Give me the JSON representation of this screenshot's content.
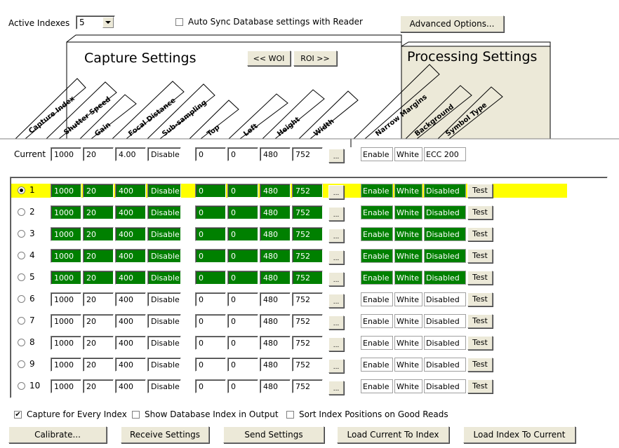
{
  "toolbar": {
    "active_indexes_label": "Active Indexes",
    "active_indexes_value": "5",
    "auto_sync_label": "Auto Sync Database settings with Reader",
    "auto_sync_checked": false,
    "advanced_options_label": "Advanced Options..."
  },
  "capture_panel": {
    "title": "Capture Settings",
    "woi_button": "<< WOI",
    "roi_button": "ROI >>",
    "headers": [
      "Capture Index",
      "Shutter Speed",
      "Gain",
      "Focal Distance",
      "Sub-sampling",
      "Top",
      "Left",
      "Height",
      "Width"
    ]
  },
  "processing_panel": {
    "title": "Processing Settings",
    "headers": [
      "Narrow Margins",
      "Background",
      "Symbol Type"
    ]
  },
  "current": {
    "label": "Current",
    "shutter": "1000",
    "gain": "20",
    "focal": "4.00",
    "subsampling": "Disable",
    "top": "0",
    "left": "0",
    "height": "480",
    "width": "752",
    "ellipsis": "...",
    "narrow_margins": "Enable",
    "background": "White",
    "symbol_type": "ECC 200"
  },
  "rows": [
    {
      "num": "1",
      "selected": true,
      "active": true,
      "shutter": "1000",
      "gain": "20",
      "focal": "400",
      "subsampling": "Disable",
      "top": "0",
      "left": "0",
      "height": "480",
      "width": "752",
      "ellipsis": "...",
      "narrow_margins": "Enable",
      "background": "White",
      "symbol_type": "Disabled",
      "test": "Test"
    },
    {
      "num": "2",
      "selected": false,
      "active": true,
      "shutter": "1000",
      "gain": "20",
      "focal": "400",
      "subsampling": "Disable",
      "top": "0",
      "left": "0",
      "height": "480",
      "width": "752",
      "ellipsis": "...",
      "narrow_margins": "Enable",
      "background": "White",
      "symbol_type": "Disabled",
      "test": "Test"
    },
    {
      "num": "3",
      "selected": false,
      "active": true,
      "shutter": "1000",
      "gain": "20",
      "focal": "400",
      "subsampling": "Disable",
      "top": "0",
      "left": "0",
      "height": "480",
      "width": "752",
      "ellipsis": "...",
      "narrow_margins": "Enable",
      "background": "White",
      "symbol_type": "Disabled",
      "test": "Test"
    },
    {
      "num": "4",
      "selected": false,
      "active": true,
      "shutter": "1000",
      "gain": "20",
      "focal": "400",
      "subsampling": "Disable",
      "top": "0",
      "left": "0",
      "height": "480",
      "width": "752",
      "ellipsis": "...",
      "narrow_margins": "Enable",
      "background": "White",
      "symbol_type": "Disabled",
      "test": "Test"
    },
    {
      "num": "5",
      "selected": false,
      "active": true,
      "shutter": "1000",
      "gain": "20",
      "focal": "400",
      "subsampling": "Disable",
      "top": "0",
      "left": "0",
      "height": "480",
      "width": "752",
      "ellipsis": "...",
      "narrow_margins": "Enable",
      "background": "White",
      "symbol_type": "Disabled",
      "test": "Test"
    },
    {
      "num": "6",
      "selected": false,
      "active": false,
      "shutter": "1000",
      "gain": "20",
      "focal": "400",
      "subsampling": "Disable",
      "top": "0",
      "left": "0",
      "height": "480",
      "width": "752",
      "ellipsis": "...",
      "narrow_margins": "Enable",
      "background": "White",
      "symbol_type": "Disabled",
      "test": "Test"
    },
    {
      "num": "7",
      "selected": false,
      "active": false,
      "shutter": "1000",
      "gain": "20",
      "focal": "400",
      "subsampling": "Disable",
      "top": "0",
      "left": "0",
      "height": "480",
      "width": "752",
      "ellipsis": "...",
      "narrow_margins": "Enable",
      "background": "White",
      "symbol_type": "Disabled",
      "test": "Test"
    },
    {
      "num": "8",
      "selected": false,
      "active": false,
      "shutter": "1000",
      "gain": "20",
      "focal": "400",
      "subsampling": "Disable",
      "top": "0",
      "left": "0",
      "height": "480",
      "width": "752",
      "ellipsis": "...",
      "narrow_margins": "Enable",
      "background": "White",
      "symbol_type": "Disabled",
      "test": "Test"
    },
    {
      "num": "9",
      "selected": false,
      "active": false,
      "shutter": "1000",
      "gain": "20",
      "focal": "400",
      "subsampling": "Disable",
      "top": "0",
      "left": "0",
      "height": "480",
      "width": "752",
      "ellipsis": "...",
      "narrow_margins": "Enable",
      "background": "White",
      "symbol_type": "Disabled",
      "test": "Test"
    },
    {
      "num": "10",
      "selected": false,
      "active": false,
      "shutter": "1000",
      "gain": "20",
      "focal": "400",
      "subsampling": "Disable",
      "top": "0",
      "left": "0",
      "height": "480",
      "width": "752",
      "ellipsis": "...",
      "narrow_margins": "Enable",
      "background": "White",
      "symbol_type": "Disabled",
      "test": "Test"
    }
  ],
  "options": {
    "capture_every_index": "Capture for Every Index",
    "capture_every_index_checked": true,
    "show_db_index": "Show Database Index in Output",
    "show_db_index_checked": false,
    "sort_index_positions": "Sort Index Positions on Good Reads",
    "sort_index_positions_checked": false
  },
  "buttons": {
    "calibrate": "Calibrate...",
    "receive_settings": "Receive Settings",
    "send_settings": "Send Settings",
    "load_current_to_index": "Load Current To Index",
    "load_index_to_current": "Load Index To Current"
  },
  "colors": {
    "active_field_bg": "#008000",
    "selected_row_bg": "#ffff00",
    "dialog_bg": "#ece9d8"
  }
}
